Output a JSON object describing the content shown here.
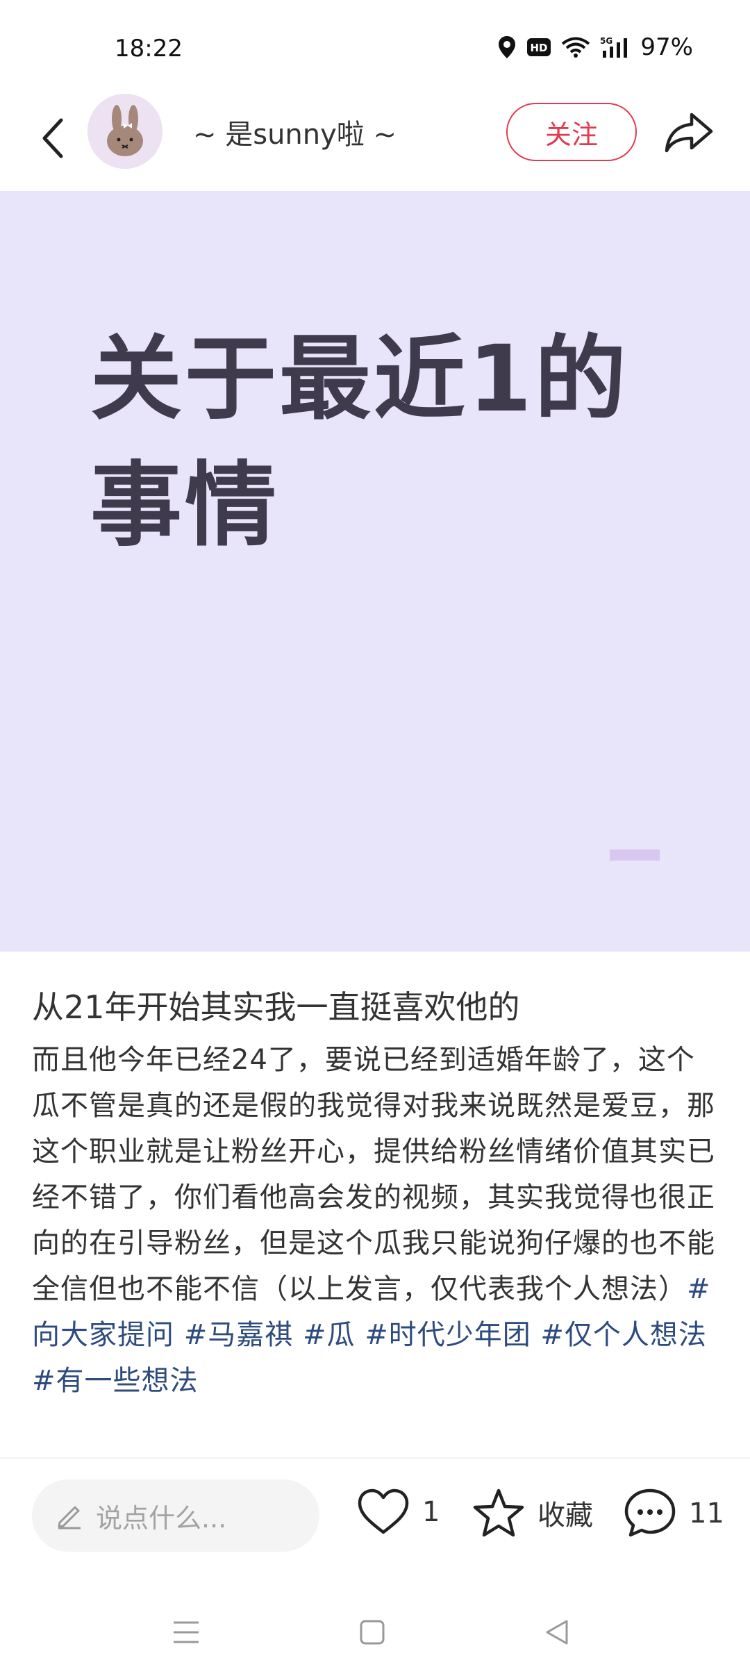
{
  "status": {
    "time": "18:22",
    "battery": "97%",
    "network": "5G"
  },
  "header": {
    "author_name": "~ 是sunny啦 ~",
    "follow_label": "关注"
  },
  "cover": {
    "title_line1": "关于最近1的",
    "title_line2": "事情",
    "background_color": "#e8e4fa"
  },
  "post": {
    "title": "从21年开始其实我一直挺喜欢他的",
    "body": "而且他今年已经24了，要说已经到适婚年龄了，这个瓜不管是真的还是假的我觉得对我来说既然是爱豆，那这个职业就是让粉丝开心，提供给粉丝情绪价值其实已经不错了，你们看他高会发的视频，其实我觉得也很正向的在引导粉丝，但是这个瓜我只能说狗仔爆的也不能全信但也不能不信（以上发言，仅代表我个人想法）",
    "tags": [
      "#向大家提问",
      "#马嘉祺",
      "#瓜",
      "#时代少年团",
      "#仅个人想法",
      "#有一些想法"
    ]
  },
  "bottom_bar": {
    "comment_placeholder": "说点什么...",
    "like_count": "1",
    "favorite_label": "收藏",
    "comment_count": "11"
  },
  "colors": {
    "accent": "#e33a4f",
    "tag": "#2d4b7d"
  }
}
